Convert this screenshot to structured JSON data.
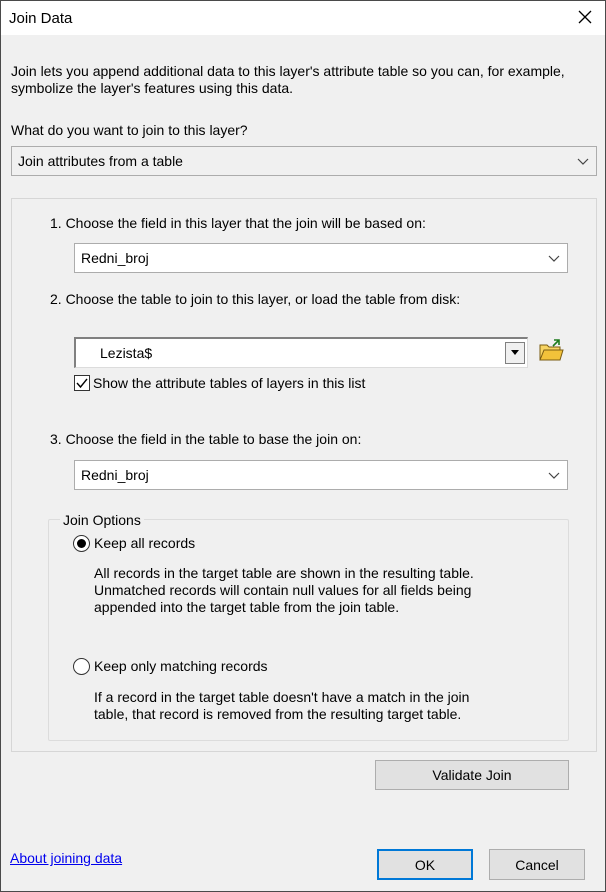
{
  "window": {
    "title": "Join Data"
  },
  "description": "Join lets you append additional data to this layer's attribute table so you can, for example, symbolize the layer's features using this data.",
  "question": "What do you want to join to this layer?",
  "join_type": {
    "selected": "Join attributes from a table"
  },
  "step1": {
    "label": "1.  Choose the field in this layer that the join will be based on:",
    "selected": "Redni_broj"
  },
  "step2": {
    "label": "2.  Choose the table to join to this layer, or load the table from disk:",
    "selected": "Lezista$",
    "checkbox_label": "Show the attribute tables of layers in this list",
    "checkbox_checked": true
  },
  "step3": {
    "label": "3.  Choose the field in the table to base the join on:",
    "selected": "Redni_broj"
  },
  "join_options": {
    "title": "Join Options",
    "keep_all": {
      "label": "Keep all records",
      "selected": true,
      "desc_lines": [
        "All records in the target table are shown in the resulting table.",
        "Unmatched records will contain null values for all fields being",
        "appended into the target table from the join table."
      ]
    },
    "keep_matching": {
      "label": "Keep only matching records",
      "selected": false,
      "desc_lines": [
        "If a record in the target table doesn't have a match in the join",
        "table, that record is removed from the resulting target table."
      ]
    }
  },
  "buttons": {
    "validate": "Validate Join",
    "ok": "OK",
    "cancel": "Cancel"
  },
  "help_link": "About joining data",
  "icons": {
    "close": "close-icon",
    "dropdown": "chevron-down-icon",
    "folder": "open-folder-icon"
  }
}
